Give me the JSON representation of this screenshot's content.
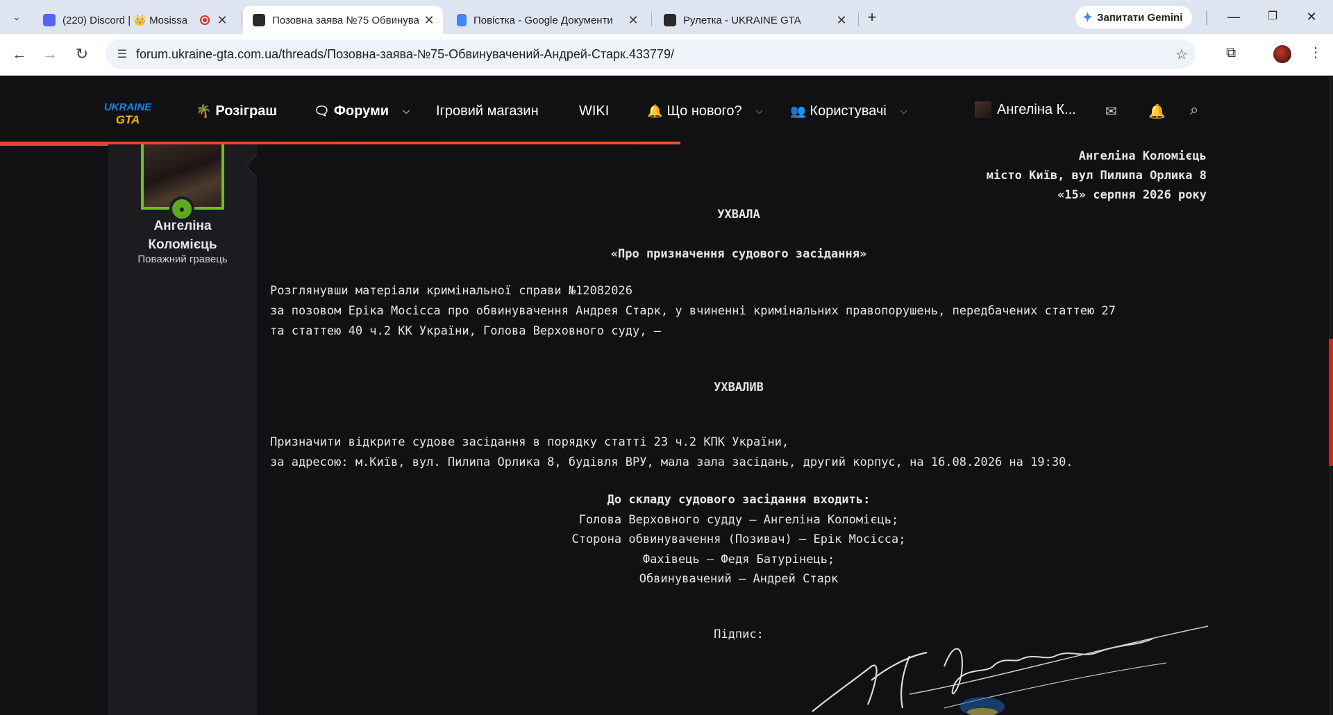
{
  "browser": {
    "tabs": [
      {
        "title": "(220) Discord | 👑 Mosissa",
        "badge": "220",
        "active": false
      },
      {
        "title": "Позовна заява №75 Обвинува",
        "active": true
      },
      {
        "title": "Повістка - Google Документи",
        "active": false
      },
      {
        "title": "Рулетка - UKRAINE GTA",
        "active": false
      }
    ],
    "gemini_label": "Запитати Gemini",
    "url": "forum.ukraine-gta.com.ua/threads/Позовна-заява-№75-Обвинувачений-Андрей-Старк.433779/"
  },
  "site": {
    "logo_top": "UKRAINE",
    "logo_bottom": "GTA",
    "nav": {
      "giveaway": "Розіграш",
      "forums": "Форуми",
      "shop": "Ігровий магазин",
      "wiki": "WIKI",
      "whats_new": "Що нового?",
      "users": "Користувачі"
    },
    "user_short": "Ангеліна К...",
    "progress_fraction": 0.512,
    "colors": {
      "accent": "#e8412a",
      "online": "#5da81f",
      "avatar_border": "#6fbf22"
    }
  },
  "post_author": {
    "name_line1": "Ангеліна",
    "name_line2": "Коломієць",
    "title": "Поважний гравець"
  },
  "document": {
    "header_right": [
      "Ангеліна Коломієць",
      "місто Київ, вул Пилипа Орлика 8",
      "«15» серпня 2026 року"
    ],
    "heading": "УХВАЛА",
    "subject": "«Про призначення судового засідання»",
    "intro": [
      "Розглянувши матеріали кримінальної справи №12082026",
      "за позовом Еріка Мосісса про обвинувачення Андрея Старк, у вчиненні кримінальних правопорушень, передбачених статтею 27",
      "та статтею 40 ч.2 КК України, Голова Верховного суду, –"
    ],
    "decision_heading": "УХВАЛИВ",
    "decision": [
      "Призначити відкрите судове засідання в порядку статті 23 ч.2 КПК України,",
      "за адресою: м.Київ, вул. Пилипа Орлика 8, будівля ВРУ, мала зала засідань, другий корпус, на 16.08.2026 на 19:30."
    ],
    "composition_heading": "До складу судового засідання входить:",
    "composition": [
      "Голова Верховного судду – Ангеліна Коломієць;",
      "Сторона обвинувачення (Позивач) – Ерік Мосісса;",
      "Фахівець – Федя Батурінець;",
      "Обвинувачений – Андрей Старк"
    ],
    "signature_label": "Підпис:"
  }
}
